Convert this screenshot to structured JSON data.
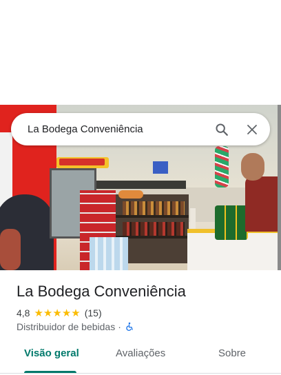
{
  "search": {
    "query": "La Bodega Conveniência"
  },
  "place": {
    "name": "La Bodega Conveniência",
    "rating": "4,8",
    "stars": 5,
    "review_count": "(15)",
    "category": "Distribuidor de bebidas",
    "separator": "·",
    "accessibility_icon": "wheelchair-icon"
  },
  "tabs": [
    {
      "label": "Visão geral",
      "selected": true
    },
    {
      "label": "Avaliações",
      "selected": false
    },
    {
      "label": "Sobre",
      "selected": false
    }
  ],
  "colors": {
    "accent": "#00796b",
    "star": "#fbbc04",
    "accessibility_icon": "#1a73e8"
  }
}
